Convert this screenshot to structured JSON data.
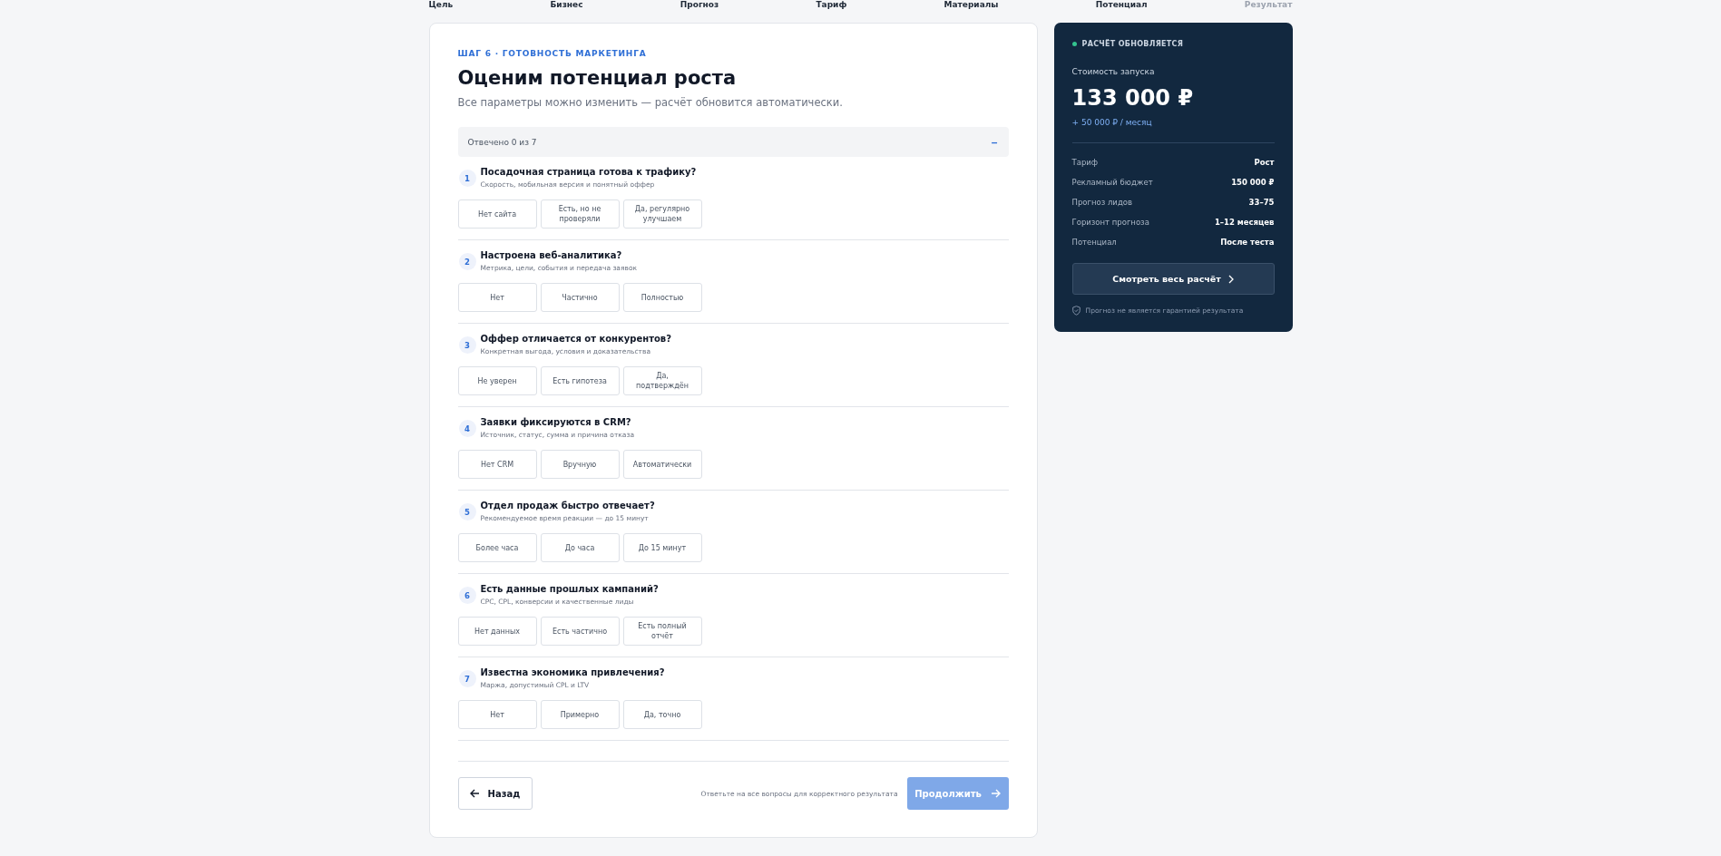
{
  "steps": [
    {
      "label": "Цель",
      "reached": true
    },
    {
      "label": "Бизнес",
      "reached": true
    },
    {
      "label": "Прогноз",
      "reached": true
    },
    {
      "label": "Тариф",
      "reached": true
    },
    {
      "label": "Материалы",
      "reached": true
    },
    {
      "label": "Потенциал",
      "reached": true
    },
    {
      "label": "Результат",
      "reached": false
    }
  ],
  "form": {
    "step_label": "ШАГ 6 · ГОТОВНОСТЬ МАРКЕТИНГА",
    "title": "Оценим потенциал роста",
    "subtitle": "Все параметры можно изменить — расчёт обновится автоматически.",
    "progress": {
      "text": "Отвечено 0 из 7",
      "toggle": "–",
      "expanded": true
    },
    "questions": [
      {
        "number": "1",
        "title": "Посадочная страница готова к трафику?",
        "hint": "Скорость, мобильная версия и понятный оффер",
        "options": [
          {
            "label": "Нет сайта",
            "selected": false
          },
          {
            "label": "Есть, но не проверяли",
            "selected": false
          },
          {
            "label": "Да, регулярно улучшаем",
            "selected": false
          }
        ]
      },
      {
        "number": "2",
        "title": "Настроена веб-аналитика?",
        "hint": "Метрика, цели, события и передача заявок",
        "options": [
          {
            "label": "Нет",
            "selected": false
          },
          {
            "label": "Частично",
            "selected": false
          },
          {
            "label": "Полностью",
            "selected": false
          }
        ]
      },
      {
        "number": "3",
        "title": "Оффер отличается от конкурентов?",
        "hint": "Конкретная выгода, условия и доказательства",
        "options": [
          {
            "label": "Не уверен",
            "selected": false
          },
          {
            "label": "Есть гипотеза",
            "selected": false
          },
          {
            "label": "Да, подтверждён",
            "selected": false
          }
        ]
      },
      {
        "number": "4",
        "title": "Заявки фиксируются в CRM?",
        "hint": "Источник, статус, сумма и причина отказа",
        "options": [
          {
            "label": "Нет CRM",
            "selected": false
          },
          {
            "label": "Вручную",
            "selected": false
          },
          {
            "label": "Автоматически",
            "selected": false
          }
        ]
      },
      {
        "number": "5",
        "title": "Отдел продаж быстро отвечает?",
        "hint": "Рекомендуемое время реакции — до 15 минут",
        "options": [
          {
            "label": "Более часа",
            "selected": false
          },
          {
            "label": "До часа",
            "selected": false
          },
          {
            "label": "До 15 минут",
            "selected": false
          }
        ]
      },
      {
        "number": "6",
        "title": "Есть данные прошлых кампаний?",
        "hint": "CPC, CPL, конверсии и качественные лиды",
        "options": [
          {
            "label": "Нет данных",
            "selected": false
          },
          {
            "label": "Есть частично",
            "selected": false
          },
          {
            "label": "Есть полный отчёт",
            "selected": false
          }
        ]
      },
      {
        "number": "7",
        "title": "Известна экономика привлечения?",
        "hint": "Маржа, допустимый CPL и LTV",
        "options": [
          {
            "label": "Нет",
            "selected": false
          },
          {
            "label": "Примерно",
            "selected": false
          },
          {
            "label": "Да, точно",
            "selected": false
          }
        ]
      }
    ],
    "back_button": "Назад",
    "footer_note": "Ответьте на все вопросы для корректного результата",
    "continue_button": {
      "label": "Продолжить",
      "disabled": true
    }
  },
  "summary": {
    "status": "РАСЧЁТ ОБНОВЛЯЕТСЯ",
    "cost_label": "Стоимость запуска",
    "cost": "133 000 ₽",
    "monthly": "+ 50 000 ₽ / месяц",
    "rows": [
      {
        "label": "Тариф",
        "value": "Рост"
      },
      {
        "label": "Рекламный бюджет",
        "value": "150 000 ₽"
      },
      {
        "label": "Прогноз лидов",
        "value": "33–75"
      },
      {
        "label": "Горизонт прогноза",
        "value": "1–12 месяцев"
      },
      {
        "label": "Потенциал",
        "value": "После теста"
      }
    ],
    "details_button": "Смотреть весь расчёт",
    "disclaimer": "Прогноз не является гарантией результата"
  }
}
